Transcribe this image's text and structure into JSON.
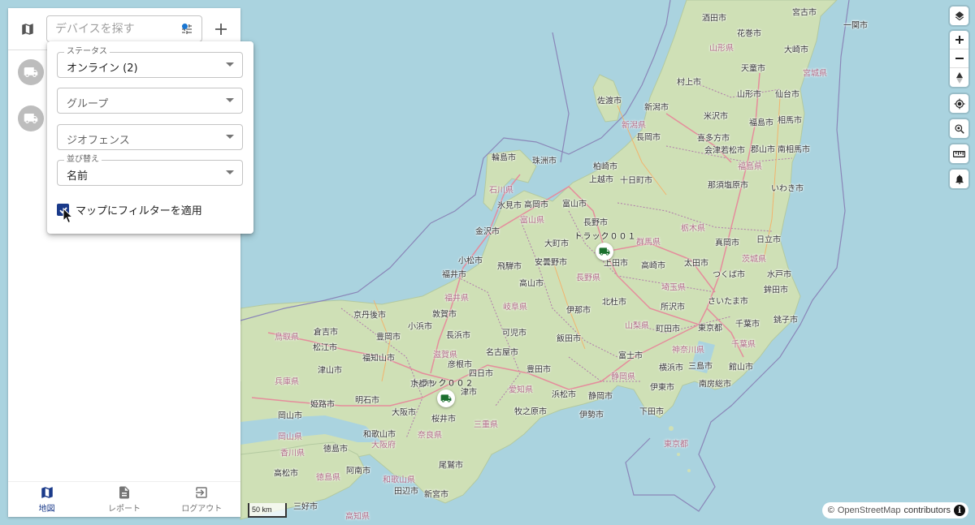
{
  "sidebar": {
    "search_placeholder": "デバイスを探す",
    "devices": [
      {
        "icon": "truck-icon"
      },
      {
        "icon": "truck-icon"
      }
    ],
    "nav": [
      {
        "label": "地図",
        "icon": "map-icon",
        "active": true
      },
      {
        "label": "レポート",
        "icon": "description-icon",
        "active": false
      },
      {
        "label": "ログアウト",
        "icon": "logout-icon",
        "active": false
      }
    ]
  },
  "filter": {
    "status_legend": "ステータス",
    "status_value": "オンライン (2)",
    "group_placeholder": "グループ",
    "geofence_placeholder": "ジオフェンス",
    "sort_legend": "並び替え",
    "sort_value": "名前",
    "apply_on_map_label": "マップにフィルターを適用",
    "apply_on_map_checked": true
  },
  "map": {
    "attribution_prefix": "©",
    "attribution_link": "OpenStreetMap",
    "attribution_suffix": "contributors",
    "scale_label": "50 km",
    "markers": [
      {
        "label": "トラック００１"
      },
      {
        "label": "トラック００２"
      }
    ],
    "labels": {
      "sakata": "酒田市",
      "miyako": "宮古市",
      "hanamaki": "花巻市",
      "ichinoseki": "一関市",
      "yamagata_pref": "山形県",
      "miyagi_pref": "宮城県",
      "tendo": "天童市",
      "yamagata": "山形市",
      "sendai": "仙台市",
      "osaki": "大崎市",
      "murakami": "村上市",
      "sado": "佐渡市",
      "niigata": "新潟市",
      "yonezawa": "米沢市",
      "fukushima": "福島市",
      "soma": "相馬市",
      "kitakata": "喜多方市",
      "aizu": "会津若松市",
      "koriyama": "郡山市",
      "minamisoma": "南相馬市",
      "niigata_pref": "新潟県",
      "fukushima_pref": "福島県",
      "iwaki": "いわき市",
      "nasushiobara": "那須塩原市",
      "kashiwazaki": "柏崎市",
      "nagaoka": "長岡市",
      "tokamachi": "十日町市",
      "joetsu": "上越市",
      "wajima": "輪島市",
      "suzu": "珠洲市",
      "ishikawa_pref": "石川県",
      "himi": "氷見市",
      "takaoka": "高岡市",
      "toyama": "富山市",
      "toyama_pref": "富山県",
      "kanazawa": "金沢市",
      "nagano": "長野市",
      "omachi": "大町市",
      "azumino": "安曇野市",
      "ueda": "上田市",
      "gunma_pref": "群馬県",
      "tochigi_pref": "栃木県",
      "ibaraki_pref": "茨城県",
      "takasaki": "高崎市",
      "ota": "太田市",
      "hitachi": "日立市",
      "utsunomiya": "真岡市",
      "tsukuba": "つくば市",
      "hokota": "鉾田市",
      "komatsu": "小松市",
      "hida": "飛騨市",
      "gujo": "高山市",
      "fukui": "福井市",
      "saitama_pref": "埼玉県",
      "mito": "水戸市",
      "ina": "伊那市",
      "hokuto": "北杜市",
      "tokorozawa": "所沢市",
      "saitama": "さいたま市",
      "fukui_pref": "福井県",
      "gifu_pref": "岐阜県",
      "nagano_pref": "長野県",
      "obama": "小浜市",
      "tsuruga": "敦賀市",
      "iida": "飯田市",
      "yamanashi_pref": "山梨県",
      "tokyo": "東京都",
      "machida": "町田市",
      "chiba": "千葉市",
      "choshi": "銚子市",
      "kyotango": "京丹後市",
      "nagahama": "長浜市",
      "kani": "可児市",
      "fuji": "富士市",
      "chiba_pref": "千葉県",
      "tottori_pref": "鳥取県",
      "kurayoshi": "倉吉市",
      "toyooka": "豊岡市",
      "hikone": "彦根市",
      "nagoya": "名古屋市",
      "shiga_pref": "滋賀県",
      "kanagawa_pref": "神奈川県",
      "matsue": "松江市",
      "fukuchiyama": "福知山市",
      "yokohama": "横浜市",
      "toyota": "豊田市",
      "shizuoka": "静岡市",
      "mishima": "三島市",
      "minamiboso": "南房総市",
      "tateyama": "館山市",
      "tsuyama": "津山市",
      "kyoto": "京都市",
      "yokkaichi": "四日市",
      "shizuoka_pref": "静岡県",
      "hyogo_pref": "兵庫県",
      "aichi_pref": "愛知県",
      "hamamatsu": "浜松市",
      "makinohara": "牧之原市",
      "okayama": "岡山市",
      "himeji": "姫路市",
      "kobe": "明石市",
      "tsu": "津市",
      "ito": "伊東市",
      "shimoda": "下田市",
      "okayama_pref": "岡山県",
      "osaka": "大阪市",
      "sakurai": "桜井市",
      "ise": "伊勢市",
      "owase": "尾鷲市",
      "tokushima": "徳島市",
      "wakayama": "和歌山市",
      "nara_pref": "奈良県",
      "mie_pref": "三重県",
      "osaka_pref": "大阪府",
      "kagawa_pref": "香川県",
      "anan": "阿南市",
      "tanabe": "田辺市",
      "tokushima_pref": "徳島県",
      "wakayama_pref": "和歌山県",
      "shingu": "新宮市",
      "tokyo_pref": "東京都",
      "kochi_pref": "高知県",
      "takamatsu": "高松市",
      "miyoshi": "三好市"
    }
  },
  "colors": {
    "primary": "#1a3a8a",
    "water": "#aad3df",
    "land": "#c8dcb4",
    "road": "#e58c9c",
    "border": "#a070a8",
    "badge": "#1976d2"
  }
}
